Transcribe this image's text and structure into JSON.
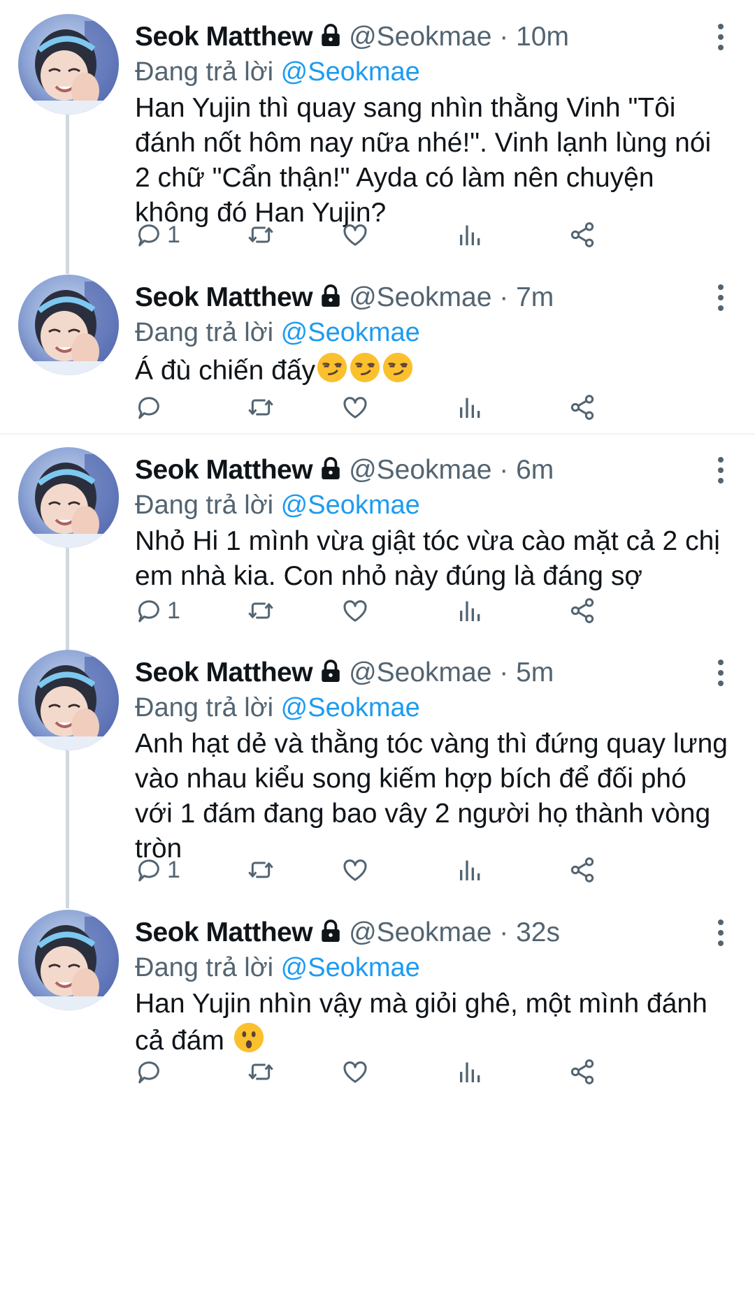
{
  "tweets": [
    {
      "name": "Seok Matthew",
      "handle": "@Seokmae",
      "time": "10m",
      "replying_prefix": "Đang trả lời ",
      "replying_to": "@Seokmae",
      "text": "Han Yujin thì quay sang nhìn thằng Vinh \"Tôi đánh nốt hôm nay nữa nhé!\". Vinh lạnh lùng nói 2 chữ \"Cẩn thận!\" Ayda có làm nên chuyện không đó Han Yujin?",
      "reply_count": "1"
    },
    {
      "name": "Seok Matthew",
      "handle": "@Seokmae",
      "time": "7m",
      "replying_prefix": "Đang trả lời ",
      "replying_to": "@Seokmae",
      "text": "Á đù chiến đấy",
      "emoji": "smirking-face x3",
      "reply_count": ""
    },
    {
      "name": "Seok Matthew",
      "handle": "@Seokmae",
      "time": "6m",
      "replying_prefix": "Đang trả lời ",
      "replying_to": "@Seokmae",
      "text": "Nhỏ Hi 1 mình vừa giật tóc vừa cào mặt cả 2 chị em nhà kia. Con nhỏ này đúng là đáng sợ",
      "reply_count": "1"
    },
    {
      "name": "Seok Matthew",
      "handle": "@Seokmae",
      "time": "5m",
      "replying_prefix": "Đang trả lời ",
      "replying_to": "@Seokmae",
      "text": "Anh hạt dẻ và thằng tóc vàng thì đứng quay lưng vào nhau kiểu song kiếm hợp bích để đối phó với 1 đám đang bao vây 2 người họ thành vòng tròn",
      "reply_count": "1"
    },
    {
      "name": "Seok Matthew",
      "handle": "@Seokmae",
      "time": "32s",
      "replying_prefix": "Đang trả lời ",
      "replying_to": "@Seokmae",
      "text": "Han Yujin nhìn vậy mà giỏi ghê, một mình đánh cả đám ",
      "emoji": "astonished-face",
      "reply_count": ""
    }
  ],
  "separator": " · ",
  "icons": {
    "reply": "reply-icon",
    "retweet": "retweet-icon",
    "like": "like-icon",
    "views": "views-icon",
    "share": "share-icon",
    "more": "more-icon",
    "lock": "lock-icon"
  },
  "colors": {
    "accent": "#1d9bf0",
    "secondary_text": "#536471",
    "thread_line": "#cfd9de"
  }
}
